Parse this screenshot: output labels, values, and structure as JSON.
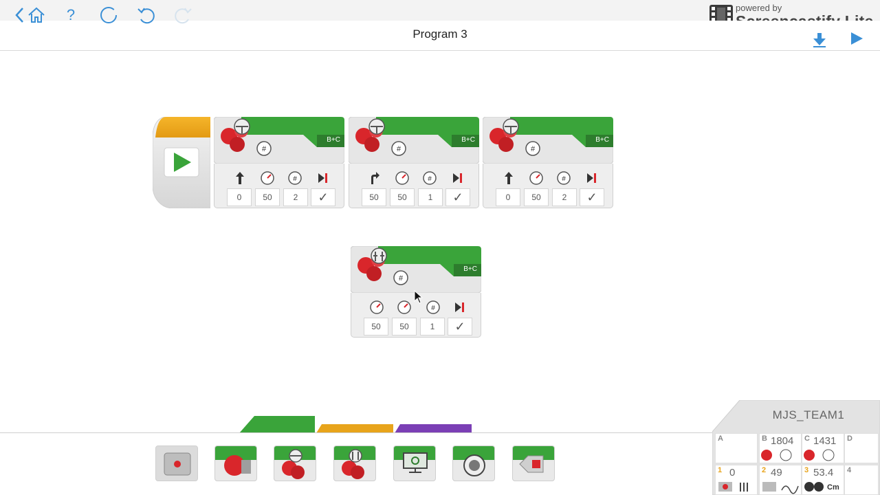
{
  "overlay": {
    "powered_by": "powered by",
    "brand_name": "Screencastify Lite"
  },
  "toolbar": {
    "title": "Program 3",
    "buttons": [
      {
        "name": "back-button",
        "icon": "chevron-left-icon"
      },
      {
        "name": "home-button",
        "icon": "home-icon"
      },
      {
        "name": "help-button",
        "icon": "question-icon",
        "label": "?"
      },
      {
        "name": "loop-button",
        "icon": "circle-icon"
      },
      {
        "name": "undo-button",
        "icon": "undo-icon"
      },
      {
        "name": "redo-button",
        "icon": "redo-icon"
      }
    ],
    "download_icon": "download-arrow-icon",
    "run_icon": "play-icon"
  },
  "program": {
    "start_icon": "play-icon",
    "blocks": [
      {
        "type": "move-steering",
        "port": "B+C",
        "values": [
          "0",
          "50",
          "2"
        ],
        "mode_icons": [
          "arrow-up-icon",
          "speed-icon",
          "rotations-icon",
          "brake-icon"
        ]
      },
      {
        "type": "move-steering",
        "port": "B+C",
        "values": [
          "50",
          "50",
          "1"
        ],
        "mode_icons": [
          "turn-right-icon",
          "speed-icon",
          "rotations-icon",
          "brake-icon"
        ]
      },
      {
        "type": "move-steering",
        "port": "B+C",
        "values": [
          "0",
          "50",
          "2"
        ],
        "mode_icons": [
          "arrow-up-icon",
          "speed-icon",
          "rotations-icon",
          "brake-icon"
        ]
      }
    ],
    "floating_block": {
      "type": "move-tank",
      "port": "B+C",
      "values": [
        "50",
        "50",
        "1"
      ],
      "mode_icons": [
        "speed-icon",
        "speed-icon",
        "rotations-icon",
        "brake-icon"
      ]
    },
    "check_mark": "✓"
  },
  "palette": {
    "tabs": [
      {
        "name": "tab-action",
        "color": "#3aa43a"
      },
      {
        "name": "tab-flow",
        "color": "#e8a41b"
      },
      {
        "name": "tab-data",
        "color": "#7b3fb5"
      }
    ],
    "items": [
      "medium-motor",
      "large-motor",
      "move-steering",
      "move-tank",
      "display",
      "sound",
      "brick-status-light"
    ]
  },
  "brick": {
    "name": "MJS_TEAM1",
    "motor_ports": [
      {
        "letter": "A",
        "value": ""
      },
      {
        "letter": "B",
        "value": "1804"
      },
      {
        "letter": "C",
        "value": "1431"
      },
      {
        "letter": "D",
        "value": ""
      }
    ],
    "sensor_ports": [
      {
        "letter": "1",
        "value": "0"
      },
      {
        "letter": "2",
        "value": "49"
      },
      {
        "letter": "3",
        "value": "53.4"
      },
      {
        "letter": "4",
        "value": ""
      }
    ],
    "sensor3_unit": "Cm"
  },
  "colors": {
    "action_green": "#3aa43a",
    "flow_orange": "#e8a41b",
    "data_purple": "#7b3fb5",
    "motor_red": "#d9262b"
  }
}
